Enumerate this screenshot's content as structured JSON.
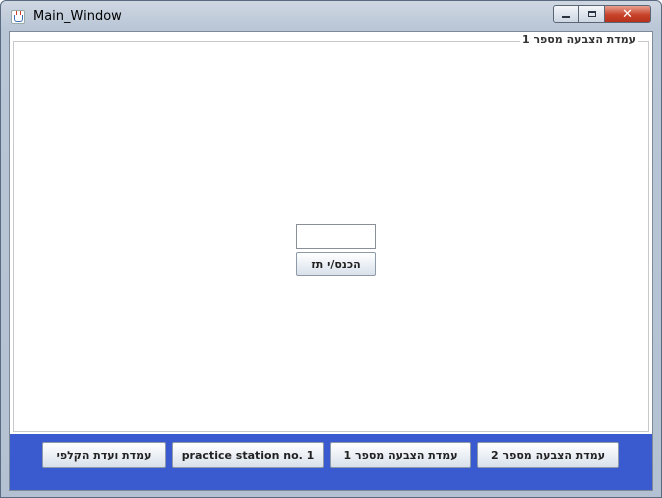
{
  "window": {
    "title": "Main_Window"
  },
  "group": {
    "title": "עמדת הצבעה מספר 1"
  },
  "id_input": {
    "value": ""
  },
  "enter_button": {
    "label": "הכנס/י תז"
  },
  "bottom_bar": {
    "color": "#3a5bd0",
    "buttons": [
      {
        "label": "עמדת ועדת הקלפי"
      },
      {
        "label": "practice station no. 1"
      },
      {
        "label": "עמדת הצבעה מספר 1"
      },
      {
        "label": "עמדת הצבעה מספר 2"
      }
    ]
  },
  "icons": {
    "app": "java-icon",
    "minimize": "minimize-icon",
    "maximize": "maximize-icon",
    "close": "close-icon"
  }
}
